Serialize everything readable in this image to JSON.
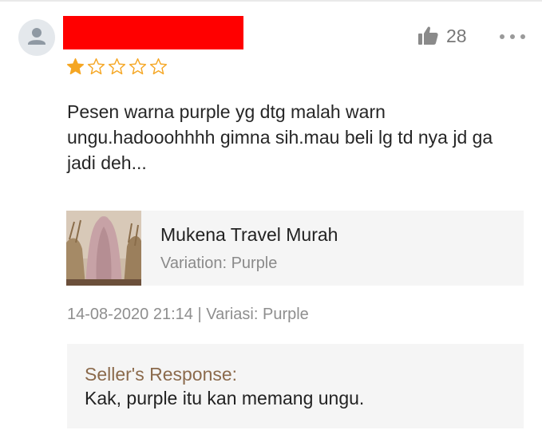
{
  "colors": {
    "star_filled": "#f5a623",
    "star_outline": "#f5a623",
    "redaction": "#ff0000",
    "seller_title": "#8b6a4c",
    "card_background": "#f5f5f5"
  },
  "review": {
    "rating": 1,
    "max_rating": 5,
    "like_count": "28",
    "text": "Pesen warna purple yg dtg malah warn ungu.hadooohhhh gimna sih.mau beli lg td nya jd ga jadi deh..."
  },
  "product": {
    "name": "Mukena Travel Murah",
    "variation": "Variation: Purple"
  },
  "meta": {
    "date_variation": "14-08-2020 21:14 | Variasi: Purple"
  },
  "seller_response": {
    "title": "Seller's Response:",
    "text": "Kak, purple itu kan memang ungu."
  },
  "icons": [
    "avatar-icon",
    "star-filled-icon",
    "star-outline-icon",
    "thumbs-up-icon",
    "more-options-icon"
  ]
}
